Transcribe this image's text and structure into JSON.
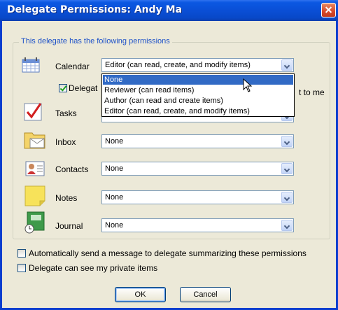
{
  "window": {
    "title": "Delegate Permissions: Andy Ma"
  },
  "group": {
    "label": "This delegate has the following permissions"
  },
  "rows": [
    {
      "label": "Calendar",
      "value": "Editor (can read, create, and modify items)",
      "icon": "calendar-icon"
    },
    {
      "label": "Tasks",
      "value": "",
      "icon": "tasks-icon"
    },
    {
      "label": "Inbox",
      "value": "None",
      "icon": "inbox-icon"
    },
    {
      "label": "Contacts",
      "value": "None",
      "icon": "contacts-icon"
    },
    {
      "label": "Notes",
      "value": "None",
      "icon": "notes-icon"
    },
    {
      "label": "Journal",
      "value": "None",
      "icon": "journal-icon"
    }
  ],
  "calendar_dropdown": {
    "options": [
      "None",
      "Reviewer (can read items)",
      "Author (can read and create items)",
      "Editor (can read, create, and modify items)"
    ],
    "highlighted_index": 0
  },
  "meeting_checkbox": {
    "label_left": "Delegat",
    "label_right": "t to me",
    "checked": true
  },
  "options": {
    "auto_send_label": "Automatically send a message to delegate summarizing these permissions",
    "private_items_label": "Delegate can see my private items"
  },
  "buttons": {
    "ok": "OK",
    "cancel": "Cancel"
  },
  "colors": {
    "title_bar": "#0a4fd6",
    "selection": "#316ac5",
    "group_label": "#1e52c8"
  }
}
